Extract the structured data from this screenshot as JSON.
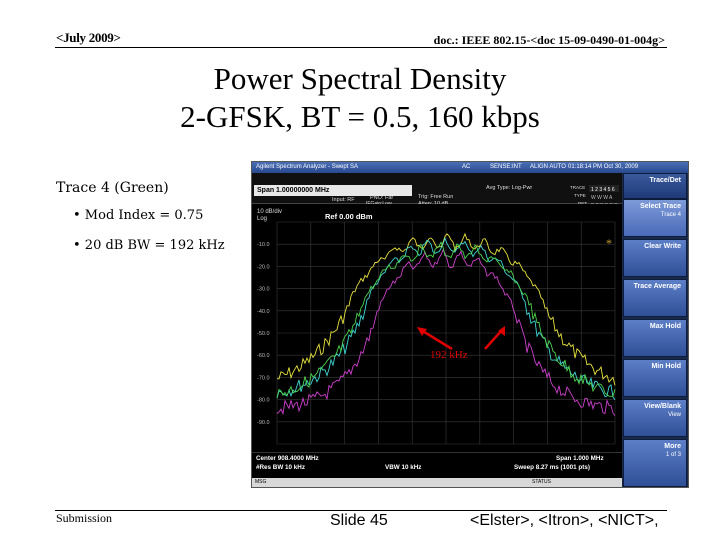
{
  "header": {
    "date": "<July 2009>",
    "doc": "doc.: IEEE 802.15-<doc 15-09-0490-01-004g>"
  },
  "title": {
    "line1": "Power Spectral Density",
    "line2": "2-GFSK, BT = 0.5, 160 kbps"
  },
  "notes": {
    "trace_label": "Trace 4 (Green)",
    "bullets": [
      "• Mod Index = 0.75",
      "• 20 dB BW = 192 kHz"
    ]
  },
  "analyzer": {
    "app_title": "Agilent Spectrum Analyzer - Swept SA",
    "top_fields": [
      "AC",
      "SENSE:INT",
      "ALIGN AUTO",
      "01:18:14 PM Oct 30, 2009"
    ],
    "span": "Span 1.00000000 MHz",
    "input_rf": "Input: RF",
    "pnol": "PNO: Far",
    "ifgain": "IFGain:Low",
    "trig": "Trig: Free Run",
    "atten": "Atten: 10 dB",
    "avg_type": "Avg Type: Log-Pwr",
    "trace_label": "TRACE",
    "type_label": "TYPE",
    "det_label": "DET",
    "scale": "10 dB/div",
    "log": "Log",
    "ref": "Ref 0.00 dBm",
    "y_ticks": [
      "-10.0",
      "-20.0",
      "-30.0",
      "-40.0",
      "-50.0",
      "-60.0",
      "-70.0",
      "-80.0",
      "-90.0"
    ],
    "annotation": "192 kHz",
    "center": "Center 908.4000 MHz",
    "res_bw": "#Res BW 10 kHz",
    "vbw": "VBW 10 kHz",
    "span_foot": "Span 1.000 MHz",
    "sweep": "Sweep 8.27 ms (1001 pts)",
    "status_left": "MSG",
    "status_right": "STATUS",
    "softkeys": [
      {
        "label": "Trace/Det",
        "sub": ""
      },
      {
        "label": "Select Trace",
        "sub": "Trace 4"
      },
      {
        "label": "Clear Write",
        "sub": ""
      },
      {
        "label": "Trace Average",
        "sub": ""
      },
      {
        "label": "Max Hold",
        "sub": ""
      },
      {
        "label": "Min Hold",
        "sub": ""
      },
      {
        "label": "View/Blank",
        "sub": "View"
      },
      {
        "label": "More",
        "sub": "1 of 3"
      }
    ]
  },
  "footer": {
    "submission": "Submission",
    "slide": "Slide 45",
    "authors": "<Elster>, <Itron>, <NICT>,"
  },
  "colors": {
    "trace_yellow": "#e6e23c",
    "trace_cyan": "#3fd6d6",
    "trace_magenta": "#d040d0",
    "trace_green": "#4cd24c",
    "arrow_red": "#e00000"
  }
}
